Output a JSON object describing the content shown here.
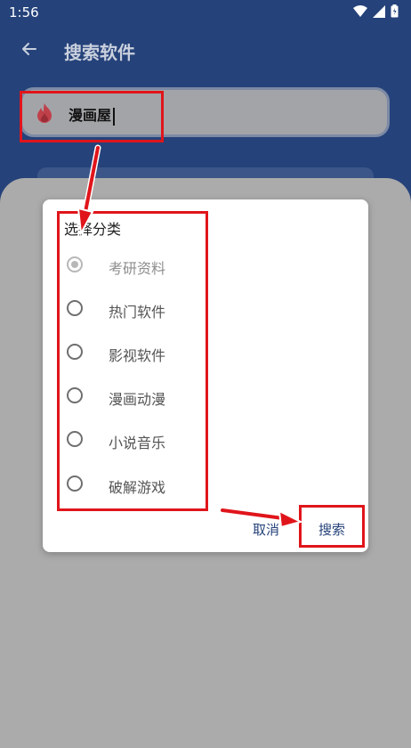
{
  "status_bar": {
    "time": "1:56"
  },
  "toolbar": {
    "title": "搜索软件"
  },
  "search": {
    "value": "漫画屋"
  },
  "dialog": {
    "title": "选择分类",
    "options": [
      {
        "label": "考研资料",
        "checked": true
      },
      {
        "label": "热门软件",
        "checked": false
      },
      {
        "label": "影视软件",
        "checked": false
      },
      {
        "label": "漫画动漫",
        "checked": false
      },
      {
        "label": "小说音乐",
        "checked": false
      },
      {
        "label": "破解游戏",
        "checked": false
      }
    ],
    "cancel_label": "取消",
    "search_label": "搜索"
  },
  "colors": {
    "appbar": "#25427a",
    "scrim": "#ababab",
    "accent": "#25427a",
    "annotation": "#e0151b"
  }
}
